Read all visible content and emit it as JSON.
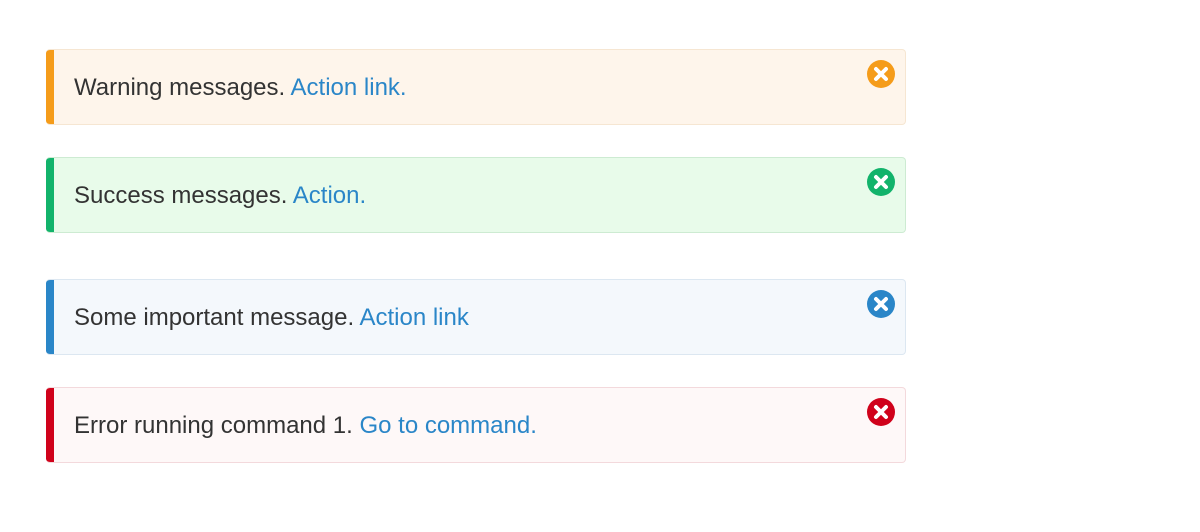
{
  "alerts": {
    "warning": {
      "message": "Warning messages.",
      "link": "Action link.",
      "color": "#f59c1a",
      "icon": "close-circle-icon"
    },
    "success": {
      "message": "Success messages.",
      "link": "Action.",
      "color": "#12b36b",
      "icon": "close-circle-icon"
    },
    "info": {
      "message": "Some important message.",
      "link": "Action link",
      "color": "#2a86c8",
      "icon": "close-circle-icon"
    },
    "error": {
      "message": "Error running command 1.",
      "link": "Go to command.",
      "color": "#d0021b",
      "icon": "close-circle-icon"
    }
  }
}
